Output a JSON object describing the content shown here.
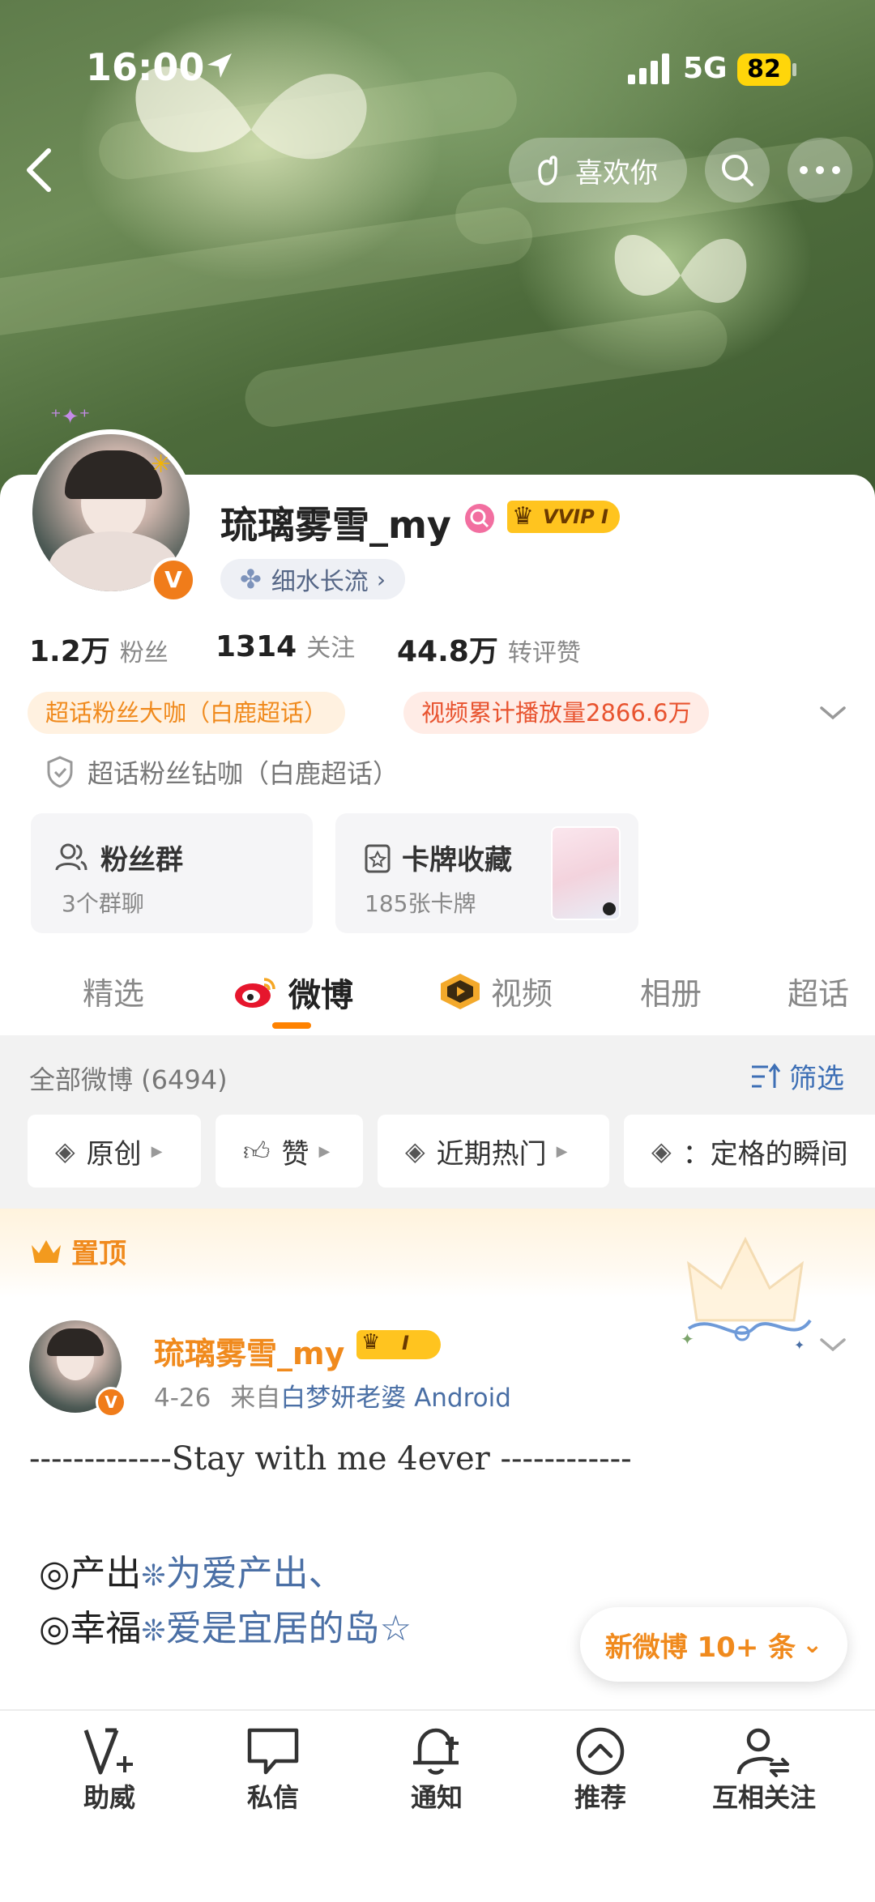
{
  "status_bar": {
    "time": "16:00",
    "network": "5G",
    "battery": "82"
  },
  "header": {
    "like_button_label": "喜欢你"
  },
  "profile": {
    "name": "琉璃雾雪_my",
    "vip_badge": "VVIP I",
    "tag_label": "细水长流",
    "stats": [
      {
        "value": "1.2万",
        "label": "粉丝"
      },
      {
        "value": "1314",
        "label": "关注"
      },
      {
        "value": "44.8万",
        "label": "转评赞"
      }
    ],
    "badges": [
      "超话粉丝大咖（白鹿超话）",
      "视频累计播放量2866.6万"
    ],
    "extra_badge": "超话粉丝钻咖（白鹿超话）",
    "tiles": [
      {
        "title": "粉丝群",
        "subtitle": "3个群聊"
      },
      {
        "title": "卡牌收藏",
        "subtitle": "185张卡牌"
      }
    ]
  },
  "tabs": [
    "精选",
    "微博",
    "视频",
    "相册",
    "超话"
  ],
  "active_tab": "微博",
  "feed": {
    "header_label": "全部微博 (6494)",
    "filter_label": "筛选",
    "chips": [
      "原创",
      "赞",
      "近期热门",
      "：定格的瞬间"
    ]
  },
  "pinned": {
    "label": "置顶",
    "author": "琉璃雾雪_my",
    "author_badge": "I",
    "date": "4-26",
    "source_prefix": "来自",
    "source": "白梦妍老婆 Android",
    "line1": "-------------Stay with me 4ever ------------",
    "line2_prefix": "◎产出",
    "line2_text": "为爱产出、",
    "line3_prefix": "◎幸福",
    "line3_text": "爱是宜居的岛",
    "new_posts_label": "新微博 10+ 条"
  },
  "bottom_nav": [
    "助威",
    "私信",
    "通知",
    "推荐",
    "互相关注"
  ],
  "colors": {
    "accent": "#f08a1d",
    "link_blue": "#4a6fa5",
    "active_tab_underline": "#ff8200"
  }
}
